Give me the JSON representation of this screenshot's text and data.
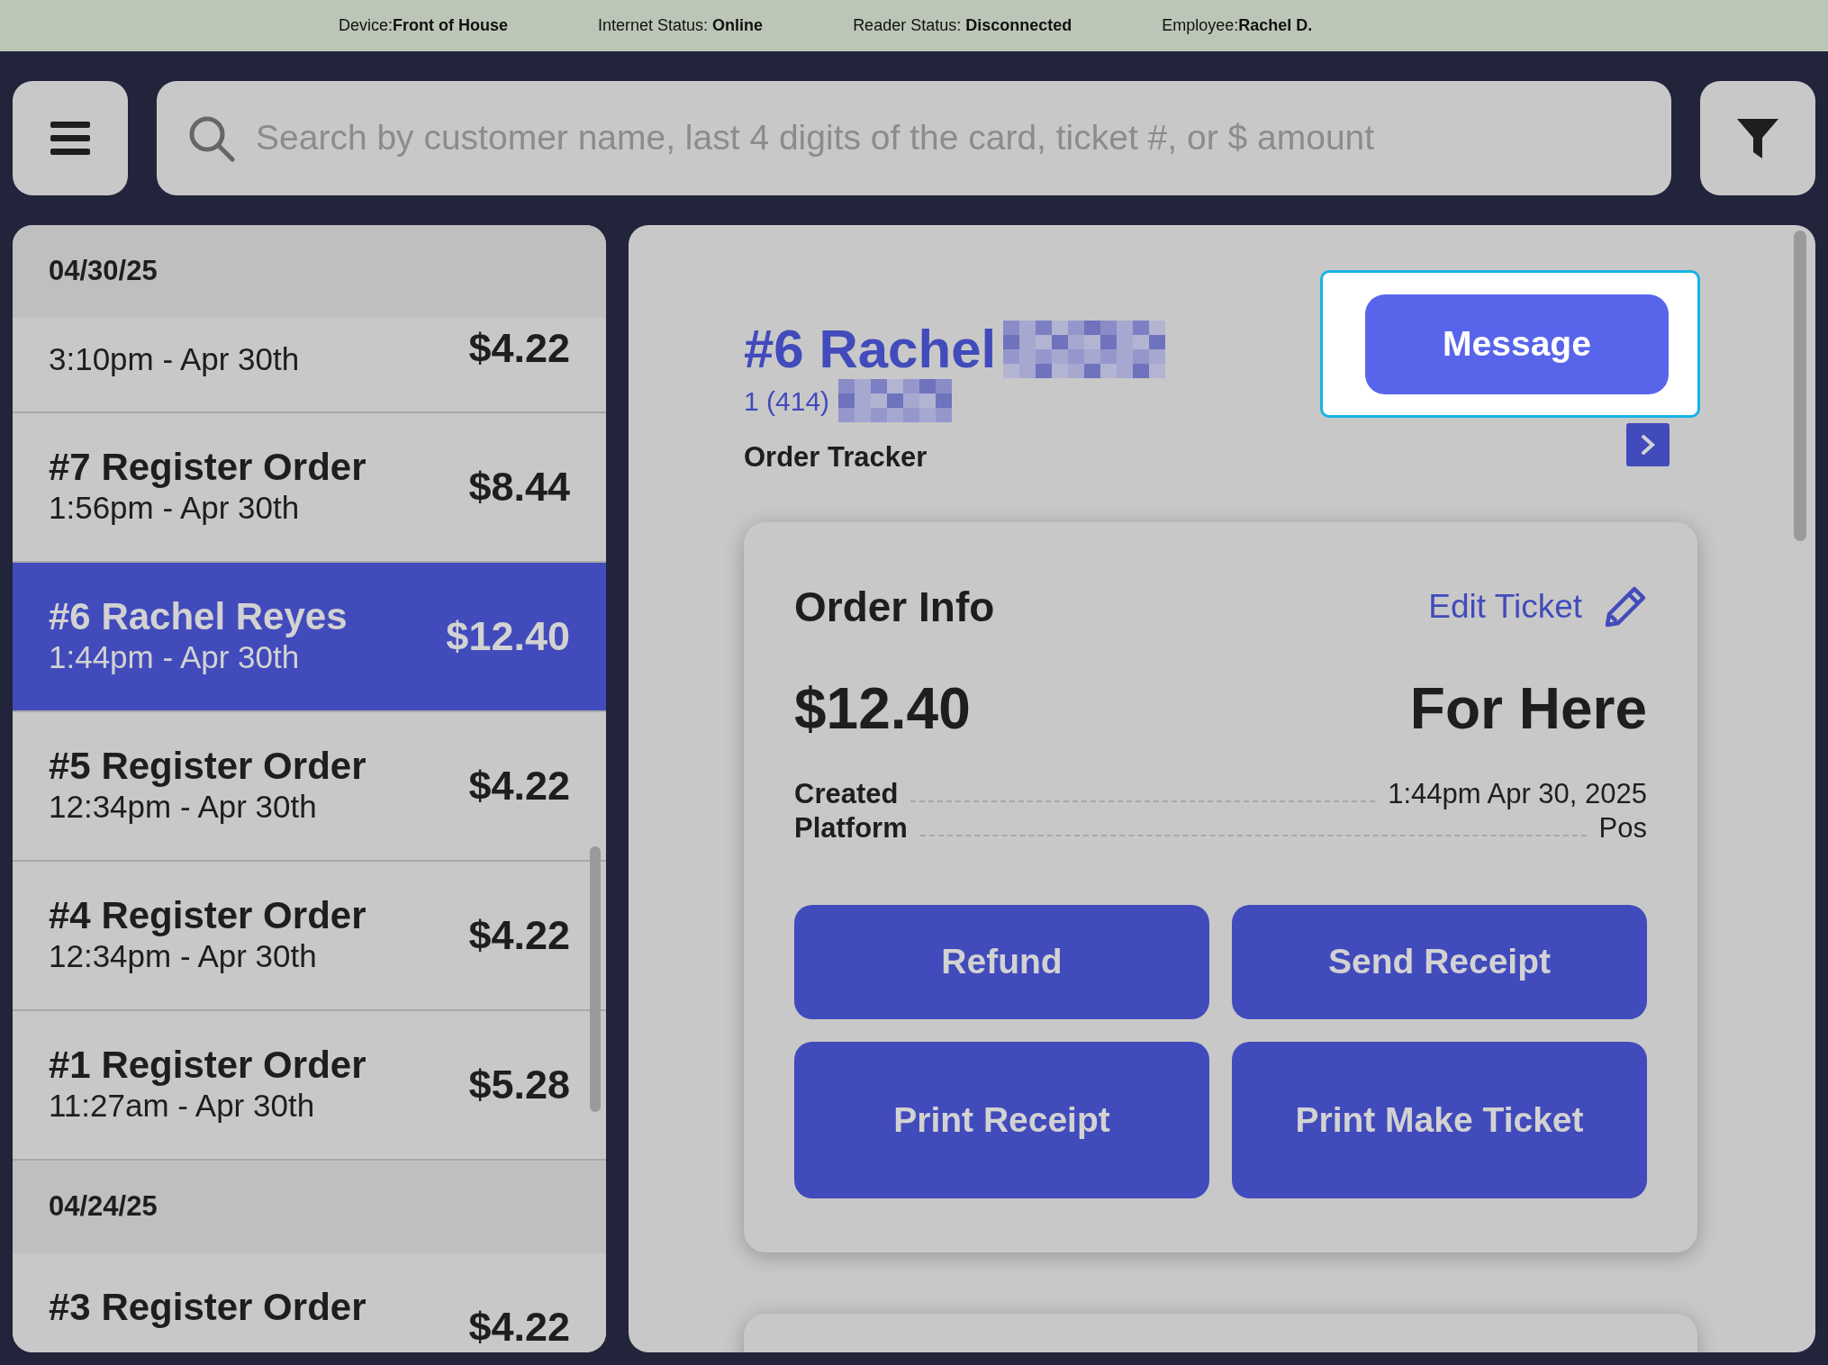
{
  "status_bar": [
    {
      "label": "Device:",
      "value": "Front of House"
    },
    {
      "label": "Internet Status: ",
      "value": "Online"
    },
    {
      "label": "Reader Status: ",
      "value": "Disconnected"
    },
    {
      "label": "Employee:",
      "value": "Rachel D."
    }
  ],
  "search": {
    "placeholder": "Search by customer name, last 4 digits of the card, ticket #, or $ amount"
  },
  "order_groups": [
    {
      "date": "04/30/25",
      "orders": [
        {
          "time": "3:10pm - Apr 30th",
          "amount": "$4.22",
          "selected": false
        },
        {
          "title": "#7 Register Order",
          "time": "1:56pm - Apr 30th",
          "amount": "$8.44",
          "selected": false
        },
        {
          "title": "#6 Rachel Reyes",
          "time": "1:44pm - Apr 30th",
          "amount": "$12.40",
          "selected": true
        },
        {
          "title": "#5 Register Order",
          "time": "12:34pm - Apr 30th",
          "amount": "$4.22",
          "selected": false
        },
        {
          "title": "#4 Register Order",
          "time": "12:34pm - Apr 30th",
          "amount": "$4.22",
          "selected": false
        },
        {
          "title": "#1 Register Order",
          "time": "11:27am - Apr 30th",
          "amount": "$5.28",
          "selected": false
        }
      ]
    },
    {
      "date": "04/24/25",
      "orders": [
        {
          "title": "#3 Register Order",
          "amount": "$4.22",
          "selected": false
        }
      ]
    }
  ],
  "detail": {
    "customer_name": "#6 Rachel",
    "phone": "1 (414)",
    "order_tracker": "Order Tracker",
    "message_button": "Message",
    "order_info": {
      "title": "Order Info",
      "edit_link": "Edit Ticket",
      "total": "$12.40",
      "dining_option": "For Here",
      "fields": [
        {
          "label": "Created",
          "value": "1:44pm Apr 30, 2025"
        },
        {
          "label": "Platform",
          "value": "Pos"
        }
      ],
      "actions": [
        "Refund",
        "Send Receipt",
        "Print Receipt",
        "Print Make Ticket"
      ]
    }
  }
}
